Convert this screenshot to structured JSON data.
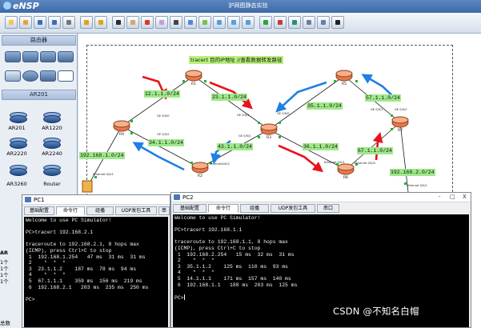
{
  "app": {
    "name": "eNSP",
    "window_title": "护网图静态实验"
  },
  "left_panel": {
    "section_routers": "路由器",
    "section_ar201": "AR201",
    "models": [
      {
        "label": "AR201"
      },
      {
        "label": "AR1220"
      },
      {
        "label": "AR2220"
      },
      {
        "label": "AR2240"
      },
      {
        "label": "AR3260"
      },
      {
        "label": "Router"
      }
    ],
    "edge_labels": [
      "AR",
      "1个",
      "1个",
      "1个",
      "1个"
    ],
    "footer": "总数"
  },
  "topology": {
    "note": "tracert 目的IP地址  //查看数据转发路径",
    "networks": [
      "12.1.1.0/24",
      "23.1.1.0/24",
      "35.1.1.0/24",
      "57.1.1.0/24",
      "34.1.1.0/24",
      "43.1.1.0/24",
      "36.1.1.0/24",
      "67.1.1.0/24",
      "192.168.1.0/24",
      "192.168.2.0/24"
    ],
    "nodes": [
      "R1",
      "R2",
      "R3",
      "R4",
      "R5",
      "R6",
      "R7"
    ],
    "ports": [
      "GE 0/0/0",
      "GE 0/0/1",
      "GE 0/0/2",
      "Ethernet 0/0/1",
      "Ethernet 0/0/0",
      "Ethernet0/0/2"
    ],
    "colors": {
      "forward_arrow": "#e8141b",
      "return_arrow": "#1e7fe6",
      "link": "#1b1b1b",
      "label_bg": "#9fe88a"
    }
  },
  "pc1": {
    "title": "PC1",
    "tabs": [
      "基础配置",
      "命令行",
      "组播",
      "UDP发包工具",
      "串"
    ],
    "active_tab": "命令行",
    "lines": [
      "Welcome to use PC Simulator!",
      "",
      "PC>tracert 192.168.2.1",
      "",
      "traceroute to 192.168.2.1, 8 hops max",
      "(ICMP), press Ctrl+C to stop",
      " 1  192.168.1.254   47 ms  31 ms  31 ms",
      " 2    *  *  *",
      " 3  23.1.1.2    187 ms  78 ms  94 ms",
      " 4    *  *  *",
      " 5  67.1.1.1    359 ms  156 ms  219 ms",
      " 6  192.168.2.1   203 ms  235 ms  250 ms",
      "",
      "PC>"
    ]
  },
  "pc2": {
    "title": "PC2",
    "tabs": [
      "基础配置",
      "命令行",
      "组播",
      "UDP发包工具",
      "串口"
    ],
    "active_tab": "命令行",
    "window_buttons": [
      "-",
      "□",
      "X"
    ],
    "lines": [
      "Welcome to use PC Simulator!",
      "",
      "PC>tracert 192.168.1.1",
      "",
      "traceroute to 192.168.1.1, 8 hops max",
      "(ICMP), press Ctrl+C to stop",
      " 1  192.168.2.254   15 ms  32 ms  31 ms",
      " 2    *  *  *",
      " 3  35.1.1.2    125 ms  110 ms  93 ms",
      " 4    *  *  *",
      " 5  14.1.1.1    171 ms  157 ms  140 ms",
      " 6  192.168.1.1   188 ms  203 ms  125 ms",
      "",
      "PC>"
    ]
  },
  "watermark": "CSDN @不知名白帽"
}
